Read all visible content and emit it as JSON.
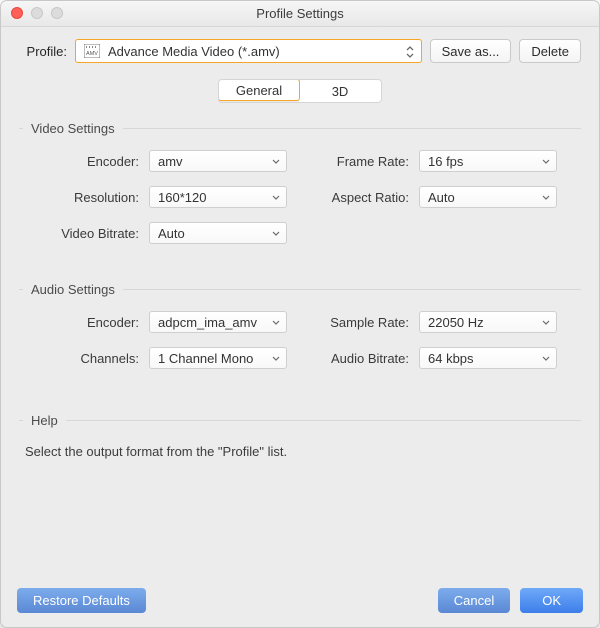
{
  "window": {
    "title": "Profile Settings"
  },
  "profile": {
    "label": "Profile:",
    "selected": "Advance Media Video (*.amv)",
    "save_as": "Save as...",
    "delete": "Delete"
  },
  "tabs": {
    "general": "General",
    "three_d": "3D"
  },
  "video": {
    "legend": "Video Settings",
    "encoder_label": "Encoder:",
    "encoder": "amv",
    "frame_rate_label": "Frame Rate:",
    "frame_rate": "16 fps",
    "resolution_label": "Resolution:",
    "resolution": "160*120",
    "aspect_ratio_label": "Aspect Ratio:",
    "aspect_ratio": "Auto",
    "video_bitrate_label": "Video Bitrate:",
    "video_bitrate": "Auto"
  },
  "audio": {
    "legend": "Audio Settings",
    "encoder_label": "Encoder:",
    "encoder": "adpcm_ima_amv",
    "sample_rate_label": "Sample Rate:",
    "sample_rate": "22050 Hz",
    "channels_label": "Channels:",
    "channels": "1 Channel Mono",
    "audio_bitrate_label": "Audio Bitrate:",
    "audio_bitrate": "64 kbps"
  },
  "help": {
    "legend": "Help",
    "text": "Select the output format from the \"Profile\" list."
  },
  "footer": {
    "restore": "Restore Defaults",
    "cancel": "Cancel",
    "ok": "OK"
  }
}
